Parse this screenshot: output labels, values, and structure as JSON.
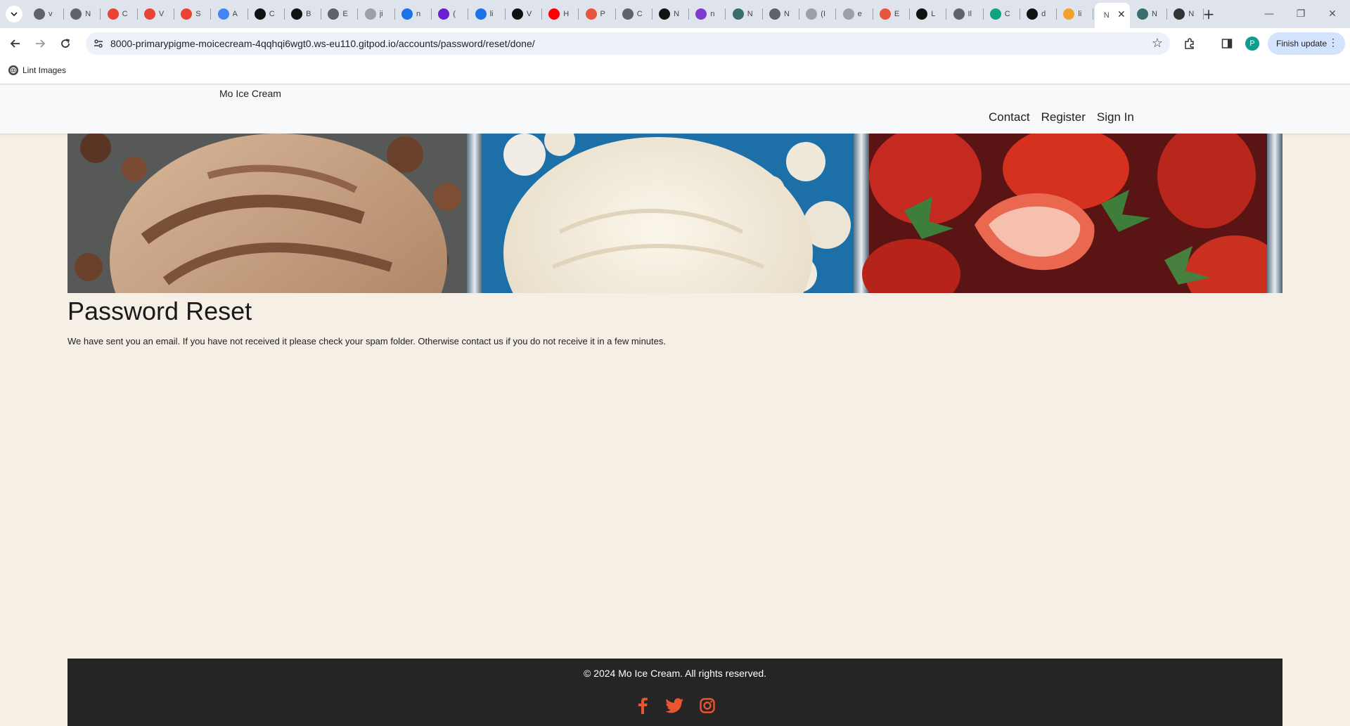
{
  "browser": {
    "tabs": [
      {
        "label": "v",
        "icon": "globe-icon",
        "color": "#5f6368"
      },
      {
        "label": "N",
        "icon": "globe-icon",
        "color": "#5f6368"
      },
      {
        "label": "C",
        "icon": "gmail-icon",
        "color": "#ea4335"
      },
      {
        "label": "V",
        "icon": "gmail-icon",
        "color": "#ea4335"
      },
      {
        "label": "S",
        "icon": "gmail-icon",
        "color": "#ea4335"
      },
      {
        "label": "A",
        "icon": "google-icon",
        "color": "#4285f4"
      },
      {
        "label": "C",
        "icon": "github-icon",
        "color": "#111111"
      },
      {
        "label": "B",
        "icon": "github-icon",
        "color": "#111111"
      },
      {
        "label": "E",
        "icon": "globe-icon",
        "color": "#5f6368"
      },
      {
        "label": "ji",
        "icon": "globe-icon",
        "color": "#9aa0a6"
      },
      {
        "label": "n",
        "icon": "copyright-icon",
        "color": "#1a73e8"
      },
      {
        "label": "(",
        "icon": "mail-icon",
        "color": "#6a1fd0"
      },
      {
        "label": "li",
        "icon": "search-icon",
        "color": "#1a73e8"
      },
      {
        "label": "V",
        "icon": "github-icon",
        "color": "#111111"
      },
      {
        "label": "H",
        "icon": "youtube-icon",
        "color": "#ff0000"
      },
      {
        "label": "P",
        "icon": "globe-icon",
        "color": "#e8553f"
      },
      {
        "label": "C",
        "icon": "globe-icon",
        "color": "#5f6368"
      },
      {
        "label": "N",
        "icon": "medium-icon",
        "color": "#111111"
      },
      {
        "label": "n",
        "icon": "h-icon",
        "color": "#7d3ccf"
      },
      {
        "label": "N",
        "icon": "image-icon",
        "color": "#3a6e6e"
      },
      {
        "label": "N",
        "icon": "globe-icon",
        "color": "#5f6368"
      },
      {
        "label": "(I",
        "icon": "globe-icon",
        "color": "#9aa0a6"
      },
      {
        "label": "e",
        "icon": "globe-icon",
        "color": "#9aa0a6"
      },
      {
        "label": "E",
        "icon": "globe-icon",
        "color": "#e8553f"
      },
      {
        "label": "L",
        "icon": "github-icon",
        "color": "#111111"
      },
      {
        "label": "Il",
        "icon": "globe-icon",
        "color": "#5f6368"
      },
      {
        "label": "C",
        "icon": "chatgpt-icon",
        "color": "#10a37f"
      },
      {
        "label": "d",
        "icon": "github-icon",
        "color": "#111111"
      },
      {
        "label": "li",
        "icon": "globe-icon",
        "color": "#f4a12b"
      }
    ],
    "active_tab": {
      "label": "N"
    },
    "tabs_after": [
      {
        "label": "N",
        "icon": "image-icon",
        "color": "#3a6e6e"
      },
      {
        "label": "N",
        "icon": "globe-icon",
        "color": "#333333"
      }
    ],
    "url": "8000-primarypigme-moicecream-4qqhqi6wgt0.ws-eu110.gitpod.io/accounts/password/reset/done/",
    "profile_initial": "P",
    "finish_update": "Finish update",
    "bookmark": "Lint Images"
  },
  "site": {
    "brand": "Mo Ice Cream",
    "nav": [
      "Contact",
      "Register",
      "Sign In"
    ],
    "title": "Password Reset",
    "message": "We have sent you an email. If you have not received it please check your spam folder. Otherwise contact us if you do not receive it in a few minutes.",
    "copyright": "© 2024 Mo Ice Cream. All rights reserved.",
    "socials": [
      "facebook-icon",
      "twitter-icon",
      "instagram-icon"
    ],
    "accent": "#e8552f"
  }
}
